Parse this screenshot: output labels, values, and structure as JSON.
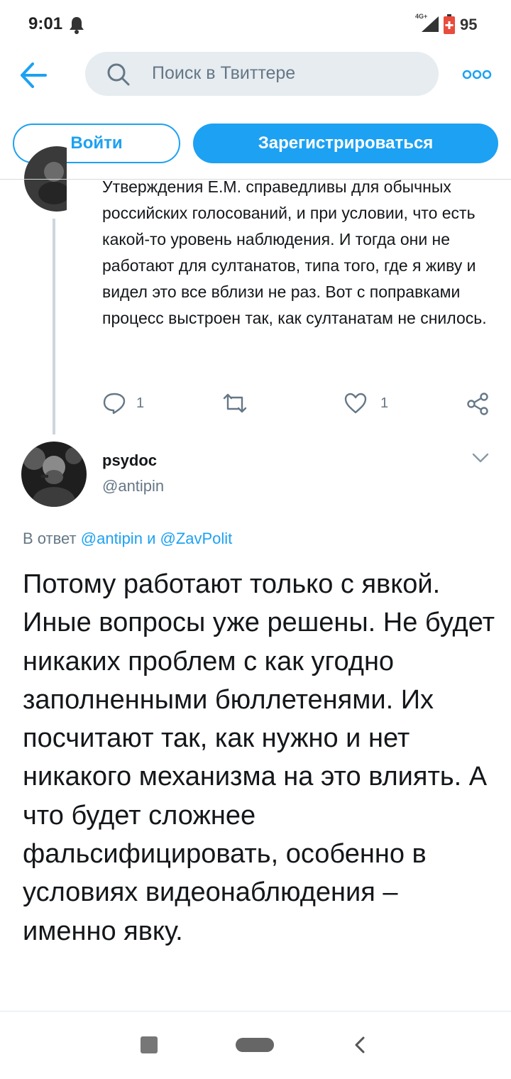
{
  "status_bar": {
    "time": "9:01",
    "network": "4G+",
    "battery": "95",
    "icons": [
      "bell-icon",
      "signal-icon",
      "battery-icon"
    ]
  },
  "header": {
    "search_placeholder": "Поиск в Твиттере",
    "icons": [
      "back-arrow-icon",
      "search-icon",
      "more-icon"
    ]
  },
  "auth": {
    "login_label": "Войти",
    "signup_label": "Зарегистрироваться"
  },
  "tweet1": {
    "text": "Утверждения Е.М.  справедливы для обычных российских голосований, и при условии, что есть какой-то уровень наблюдения. И тогда они не работают для султанатов, типа того, где я живу и видел это все вблизи не раз. Вот с поправками процесс выстроен так, как султанатам не снилось.",
    "replies": "1",
    "likes": "1"
  },
  "tweet2": {
    "name": "psydoc",
    "handle": "@antipin",
    "reply_prefix": "В ответ",
    "reply_user1": "@antipin",
    "reply_conj": "и",
    "reply_user2": "@ZavPolit",
    "text": "Потому работают только с явкой. Иные вопросы уже решены. Не будет никаких проблем с как угодно заполненными бюллетенями. Их посчитают так, как нужно и нет никакого механизма на это влиять. А что будет сложнее фальсифицировать, особенно в условиях видеонаблюдения – именно явку."
  },
  "colors": {
    "accent": "#1da1f2",
    "muted": "#657786",
    "text": "#14171a",
    "search_bg": "#e6ecf0"
  }
}
